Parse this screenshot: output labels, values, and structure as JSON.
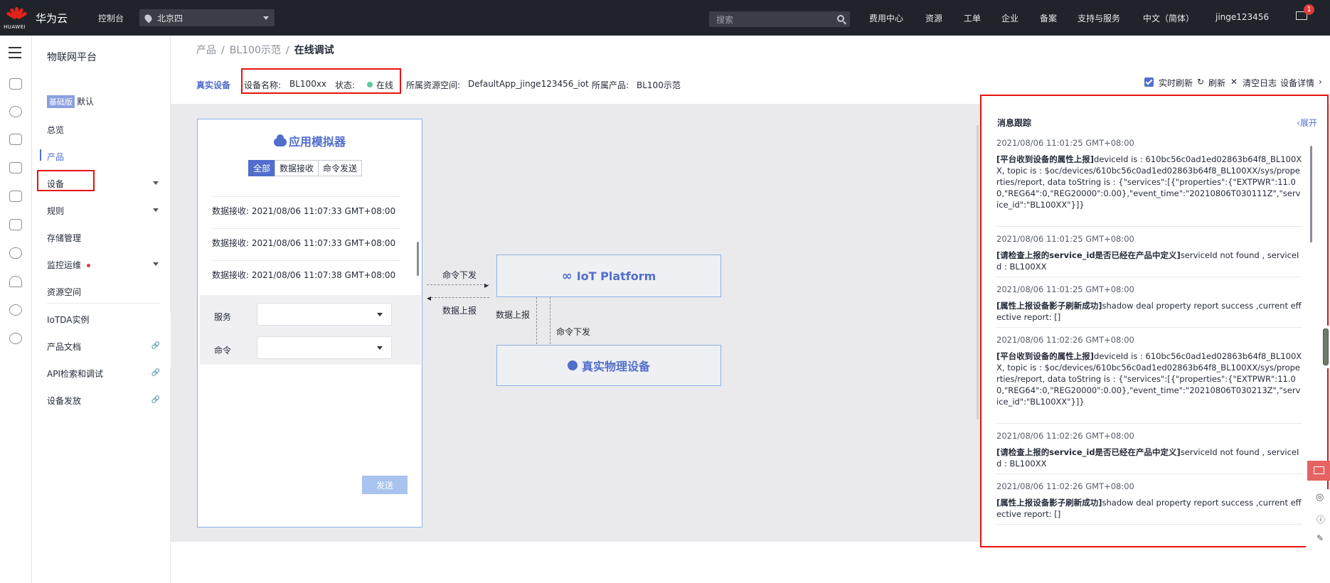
{
  "topbar": {
    "brand": "华为云",
    "brand_sub": "HUAWEI",
    "console": "控制台",
    "region": "北京四",
    "search_placeholder": "搜索",
    "nav": [
      "费用中心",
      "资源",
      "工单",
      "企业",
      "备案",
      "支持与服务",
      "中文（简体）",
      "jinge123456"
    ],
    "notification_count": "1"
  },
  "sidebar": {
    "title": "物联网平台",
    "edition_badge": "基础版",
    "edition_name": "默认",
    "items": [
      "总览",
      "产品",
      "设备",
      "规则",
      "存储管理",
      "监控运维",
      "资源空间",
      "IoTDA实例",
      "产品文档",
      "API检索和调试",
      "设备发放"
    ]
  },
  "breadcrumb": [
    "产品",
    "BL100示范",
    "在线调试"
  ],
  "device_bar": {
    "type": "真实设备",
    "name_label": "设备名称:",
    "name": "BL100xx",
    "status_label": "状态:",
    "status": "在线",
    "space_label": "所属资源空间:",
    "space": "DefaultApp_jinge123456_iot",
    "product_label": "所属产品:",
    "product": "BL100示范"
  },
  "controls": {
    "realtime": "实时刷新",
    "refresh": "刷新",
    "clear": "清空日志",
    "details": "设备详情"
  },
  "simulator": {
    "title": "应用模拟器",
    "tabs": [
      "全部",
      "数据接收",
      "命令发送"
    ],
    "messages": [
      "数据接收: 2021/08/06 11:07:33 GMT+08:00",
      "数据接收: 2021/08/06 11:07:33 GMT+08:00",
      "数据接收: 2021/08/06 11:07:38 GMT+08:00"
    ],
    "service_label": "服务",
    "command_label": "命令",
    "send": "发送"
  },
  "flow": {
    "iot_platform": "IoT Platform",
    "real_device": "真实物理设备",
    "cmd_down": "命令下发",
    "data_up": "数据上报",
    "data_up2": "数据上报",
    "cmd_down2": "命令下发"
  },
  "trace": {
    "title": "消息跟踪",
    "expand": "展开",
    "entries": [
      {
        "ts": "2021/08/06 11:01:25 GMT+08:00",
        "tag": "[平台收到设备的属性上报]",
        "text": "deviceId is : 610bc56c0ad1ed02863b64f8_BL100XX, topic is : $oc/devices/610bc56c0ad1ed02863b64f8_BL100XX/sys/properties/report, data toString is : {\"services\":[{\"properties\":{\"EXTPWR\":11.00,\"REG64\":0,\"REG20000\":0.00},\"event_time\":\"20210806T030111Z\",\"service_id\":\"BL100XX\"}]}"
      },
      {
        "ts": "2021/08/06 11:01:25 GMT+08:00",
        "tag": "[请检查上报的service_id是否已经在产品中定义]",
        "text": "serviceId not found , serviceId : BL100XX"
      },
      {
        "ts": "2021/08/06 11:01:25 GMT+08:00",
        "tag": "[属性上报设备影子刷新成功]",
        "text": "shadow deal property report success ,current effective report: []"
      },
      {
        "ts": "2021/08/06 11:02:26 GMT+08:00",
        "tag": "[平台收到设备的属性上报]",
        "text": "deviceId is : 610bc56c0ad1ed02863b64f8_BL100XX, topic is : $oc/devices/610bc56c0ad1ed02863b64f8_BL100XX/sys/properties/report, data toString is : {\"services\":[{\"properties\":{\"EXTPWR\":11.00,\"REG64\":0,\"REG20000\":0.00},\"event_time\":\"20210806T030213Z\",\"service_id\":\"BL100XX\"}]}"
      },
      {
        "ts": "2021/08/06 11:02:26 GMT+08:00",
        "tag": "[请检查上报的service_id是否已经在产品中定义]",
        "text": "serviceId not found , serviceId : BL100XX"
      },
      {
        "ts": "2021/08/06 11:02:26 GMT+08:00",
        "tag": "[属性上报设备影子刷新成功]",
        "text": "shadow deal property report success ,current effective report: []"
      }
    ]
  }
}
